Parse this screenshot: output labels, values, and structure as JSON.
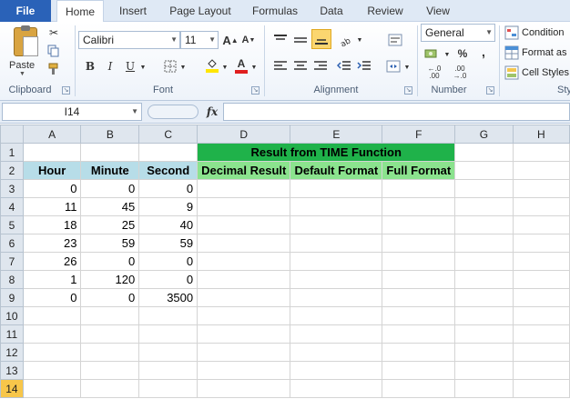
{
  "tabs": {
    "file": "File",
    "home": "Home",
    "insert": "Insert",
    "page_layout": "Page Layout",
    "formulas": "Formulas",
    "data": "Data",
    "review": "Review",
    "view": "View"
  },
  "ribbon": {
    "clipboard": {
      "label": "Clipboard",
      "paste": "Paste"
    },
    "font": {
      "label": "Font",
      "name": "Calibri",
      "size": "11",
      "bold": "B",
      "italic": "I",
      "underline": "U",
      "grow": "A",
      "shrink": "A",
      "font_color": "A"
    },
    "alignment": {
      "label": "Alignment"
    },
    "number": {
      "label": "Number",
      "format": "General",
      "percent": "%",
      "comma": ",",
      "inc_decimal": "←.0\n.00",
      "dec_decimal": ".00\n→.0",
      "accounting": "$"
    },
    "styles": {
      "label": "Sty",
      "conditional": "Condition",
      "format_as": "Format as",
      "cell_styles": "Cell Styles"
    }
  },
  "formula_bar": {
    "name_box": "I14",
    "fx": "fx",
    "formula": ""
  },
  "sheet": {
    "columns": [
      "A",
      "B",
      "C",
      "D",
      "E",
      "F",
      "G",
      "H"
    ],
    "row_numbers": [
      "1",
      "2",
      "3",
      "4",
      "5",
      "6",
      "7",
      "8",
      "9",
      "10",
      "11",
      "12",
      "13",
      "14"
    ],
    "selected_row": "14",
    "title": "Result from TIME Function",
    "headers": [
      "Hour",
      "Minute",
      "Second",
      "Decimal Result",
      "Default Format",
      "Full Format"
    ],
    "data": [
      [
        "0",
        "0",
        "0"
      ],
      [
        "11",
        "45",
        "9"
      ],
      [
        "18",
        "25",
        "40"
      ],
      [
        "23",
        "59",
        "59"
      ],
      [
        "26",
        "0",
        "0"
      ],
      [
        "1",
        "120",
        "0"
      ],
      [
        "0",
        "0",
        "3500"
      ]
    ],
    "colors": {
      "title_fill": "#1fb24a",
      "header_blue": "#b7dde8",
      "header_green": "#8be38e",
      "selected_row": "#f7c64a"
    }
  }
}
